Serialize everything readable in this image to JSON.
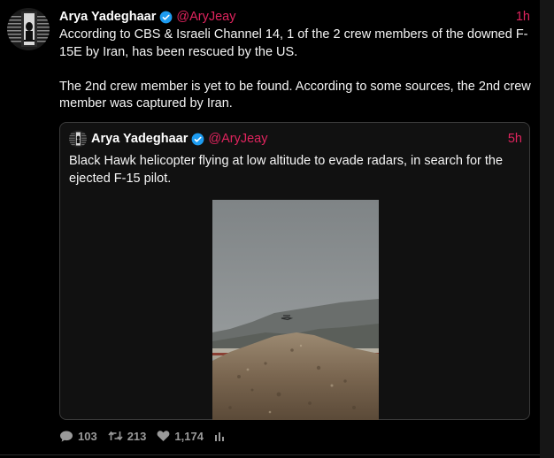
{
  "tweet": {
    "author_name": "Arya Yadeghaar",
    "handle": "@AryJeay",
    "time": "1h",
    "paragraphs": [
      "According to CBS & Israeli Channel 14, 1 of the 2 crew members of the downed F-15E by Iran, has been rescued by the US.",
      "The 2nd crew member is yet to be found. According to some sources, the 2nd crew member was captured by Iran."
    ]
  },
  "quote": {
    "author_name": "Arya Yadeghaar",
    "handle": "@AryJeay",
    "time": "5h",
    "text": "Black Hawk helicopter flying at low altitude to evade radars, in search for the ejected F-15 pilot."
  },
  "stats": {
    "replies": "103",
    "retweets": "213",
    "likes": "1,174"
  },
  "colors": {
    "accent": "#e0245e",
    "verified": "#1d9bf0",
    "background": "#000000",
    "quote_background": "#111111"
  },
  "icons": {
    "verified": "verified-badge-icon",
    "reply": "speech-bubble-icon",
    "retweet": "retweet-icon",
    "like": "heart-icon",
    "analytics": "bar-chart-icon"
  }
}
